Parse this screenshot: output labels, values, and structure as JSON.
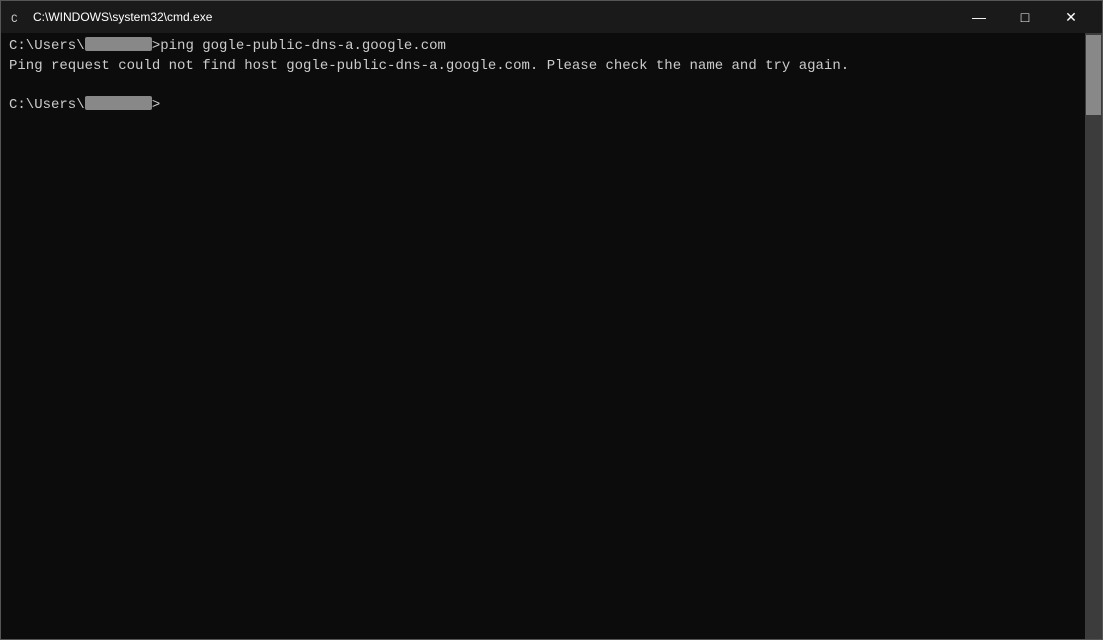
{
  "titleBar": {
    "icon": "cmd-icon",
    "title": "C:\\WINDOWS\\system32\\cmd.exe",
    "minimize": "—",
    "maximize": "□",
    "close": "✕"
  },
  "console": {
    "lines": [
      {
        "type": "prompt_command",
        "prompt": "C:\\Users\\",
        "redacted": true,
        "command": ">ping gogle-public-dns-a.google.com"
      },
      {
        "type": "output",
        "text": "Ping request could not find host gogle-public-dns-a.google.com. Please check the name and try again."
      },
      {
        "type": "empty",
        "text": ""
      },
      {
        "type": "prompt_only",
        "prompt": "C:\\Users\\",
        "redacted": true,
        "suffix": ">"
      }
    ]
  }
}
